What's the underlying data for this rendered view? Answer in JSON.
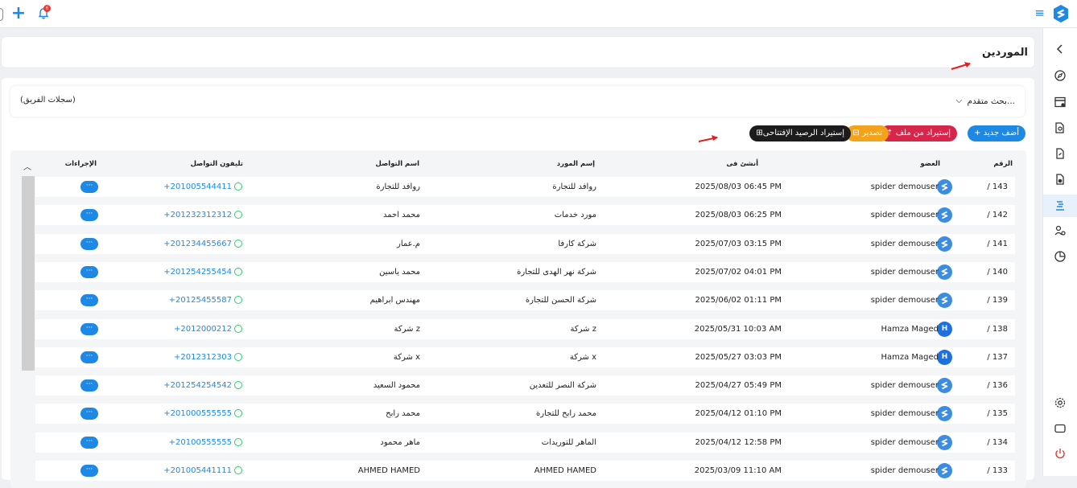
{
  "header": {
    "notification_count": "6",
    "add_label": "+"
  },
  "page": {
    "title": "الموردين"
  },
  "search": {
    "advanced_label": "بحث متقدم...",
    "team_records_label": "(سجلات الفريق)"
  },
  "toolbar": {
    "add_label": "+ أضف جديد",
    "import_label": "⇡ إستيراد من ملف",
    "export_label": "⊟ تصدير",
    "opening_balance_label": "⊞إستيراد الرصيد الإفتتاحى"
  },
  "table": {
    "columns": {
      "number": "الرقم",
      "member": "العضو",
      "created_at": "أنشئ فى",
      "supplier_name": "إسم المورد",
      "contact_name": "اسم التواصل",
      "phone": "تليفون التواصل",
      "actions": "الإجراءات"
    },
    "rows": [
      {
        "number": "/ 143",
        "member": "spider demouser",
        "avatar": "logo",
        "created_at": "2025/08/03 06:45 PM",
        "supplier_name": "روافد للتجارة",
        "contact_name": "روافد للتجارة",
        "phone": "+201005544411",
        "actions": "···"
      },
      {
        "number": "/ 142",
        "member": "spider demouser",
        "avatar": "logo",
        "created_at": "2025/08/03 06:25 PM",
        "supplier_name": "مورد خدمات",
        "contact_name": "محمد احمد",
        "phone": "+201232312312",
        "actions": "···"
      },
      {
        "number": "/ 141",
        "member": "spider demouser",
        "avatar": "logo",
        "created_at": "2025/07/03 03:15 PM",
        "supplier_name": "شركة كارفا",
        "contact_name": "م.عمار",
        "phone": "+201234455667",
        "actions": "···"
      },
      {
        "number": "/ 140",
        "member": "spider demouser",
        "avatar": "logo",
        "created_at": "2025/07/02 04:01 PM",
        "supplier_name": "شركة  نهر الهدى للتجارة",
        "contact_name": "محمد ياسين",
        "phone": "+201254255454",
        "actions": "···"
      },
      {
        "number": "/ 139",
        "member": "spider demouser",
        "avatar": "logo",
        "created_at": "2025/06/02 01:11 PM",
        "supplier_name": "شركة الحسن للتجارة",
        "contact_name": "مهندس ابراهيم",
        "phone": "+20125455587",
        "actions": "···"
      },
      {
        "number": "/ 138",
        "member": "Hamza Maged",
        "avatar": "H",
        "created_at": "2025/05/31 10:03 AM",
        "supplier_name": "شركة z",
        "contact_name": "شركة z",
        "phone": "+2012000212",
        "actions": "···"
      },
      {
        "number": "/ 137",
        "member": "Hamza Maged",
        "avatar": "H",
        "created_at": "2025/05/27 03:03 PM",
        "supplier_name": "شركة x",
        "contact_name": "شركة x",
        "phone": "+2012312303",
        "actions": "···"
      },
      {
        "number": "/ 136",
        "member": "spider demouser",
        "avatar": "logo",
        "created_at": "2025/04/27 05:49 PM",
        "supplier_name": "شركة النصر للتعدين",
        "contact_name": "محمود السعيد",
        "phone": "+201254254542",
        "actions": "···"
      },
      {
        "number": "/ 135",
        "member": "spider demouser",
        "avatar": "logo",
        "created_at": "2025/04/12 01:10 PM",
        "supplier_name": "محمد رابح للتجارة",
        "contact_name": "محمد رابح",
        "phone": "+201000555555",
        "actions": "···"
      },
      {
        "number": "/ 134",
        "member": "spider demouser",
        "avatar": "logo",
        "created_at": "2025/04/12 12:58 PM",
        "supplier_name": "الماهر للتوريدات",
        "contact_name": "ماهر محمود",
        "phone": "+20100555555",
        "actions": "···"
      },
      {
        "number": "/ 133",
        "member": "spider demouser",
        "avatar": "logo",
        "created_at": "2025/03/09 11:10 AM",
        "supplier_name": "AHMED HAMED",
        "contact_name": "AHMED HAMED",
        "phone": "+201005441111",
        "actions": "···"
      }
    ]
  },
  "colors": {
    "accent": "#1e88e5",
    "danger": "#d7264b",
    "warning": "#f2a21b",
    "dark": "#1c1c1c",
    "annotation_arrow": "#e02020"
  },
  "sidebar": {
    "icons": [
      "chevron-left-icon",
      "compass-icon",
      "storage-icon",
      "document-search-icon",
      "file-link-icon",
      "file-user-icon",
      "suppliers-icon",
      "users-gear-icon",
      "report-chart-icon",
      "settings-icon",
      "screen-icon",
      "power-icon"
    ]
  }
}
